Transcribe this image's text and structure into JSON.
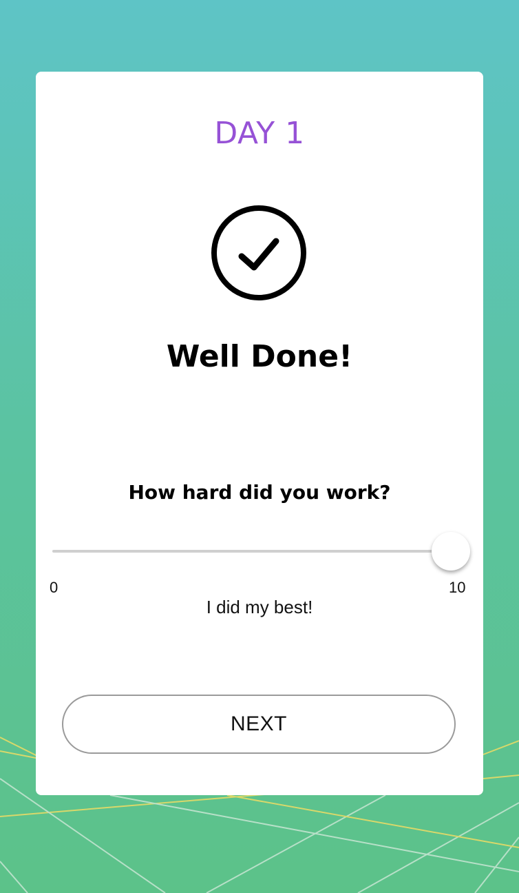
{
  "header": {
    "day_label": "DAY 1"
  },
  "status": {
    "icon": "check-circle-icon",
    "headline": "Well Done!"
  },
  "effort": {
    "question": "How hard did you work?",
    "slider": {
      "min": "0",
      "max": "10",
      "value": 10
    },
    "level_text": "I did my best!"
  },
  "actions": {
    "next_label": "NEXT"
  },
  "colors": {
    "accent": "#9652d6",
    "background_top": "#5ec4c6",
    "background_bottom": "#5cc289",
    "card": "#ffffff"
  }
}
